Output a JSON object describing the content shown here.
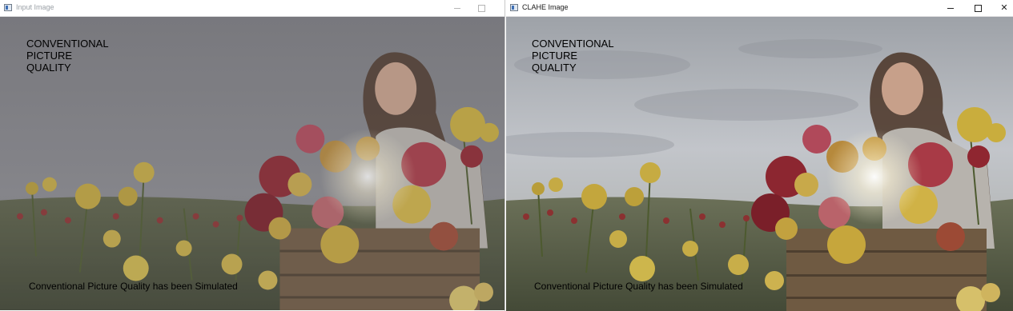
{
  "windows": [
    {
      "title": "Input Image",
      "icon": "app-window-icon",
      "controls": [
        "minimize-icon",
        "maximize-icon"
      ],
      "overlay_lines": [
        "CONVENTIONAL",
        "PICTURE",
        "QUALITY"
      ],
      "caption": "Conventional Picture Quality has been Simulated"
    },
    {
      "title": "CLAHE Image",
      "icon": "app-window-icon",
      "controls": [
        "minimize-icon",
        "maximize-icon",
        "close-icon"
      ],
      "overlay_lines": [
        "CONVENTIONAL",
        "PICTURE",
        "QUALITY"
      ],
      "caption": "Conventional Picture Quality has been Simulated"
    }
  ],
  "control_glyphs": {
    "close": "✕"
  }
}
